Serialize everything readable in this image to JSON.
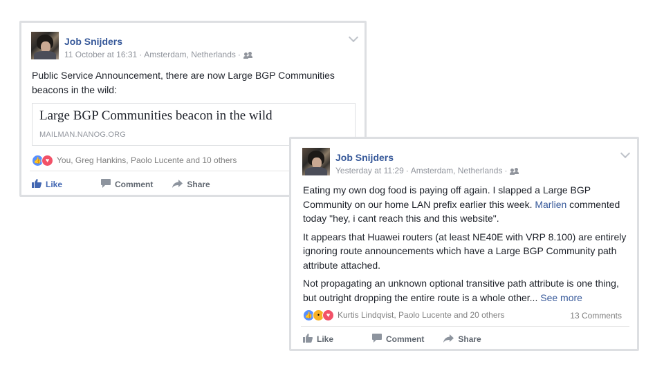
{
  "posts": [
    {
      "author": "Job Snijders",
      "time": "11 October at 16:31",
      "location": "Amsterdam, Netherlands",
      "body": "Public Service Announcement, there are now Large BGP Communities beacons in the wild:",
      "attachment": {
        "title": "Large BGP Communities beacon in the wild",
        "domain": "MAILMAN.NANOG.ORG"
      },
      "reactions_text": "You, Greg Hankins, Paolo Lucente and 10 others",
      "actions": {
        "like": "Like",
        "comment": "Comment",
        "share": "Share"
      }
    },
    {
      "author": "Job Snijders",
      "time": "Yesterday at 11:29",
      "location": "Amsterdam, Netherlands",
      "para1_before": "Eating my own dog food is paying off again. I slapped a Large BGP Community on our home LAN prefix earlier this week. ",
      "para1_link": "Marlien",
      "para1_after": " commented today \"hey, i cant reach this and this website\".",
      "para2": "It appears that Huawei routers (at least NE40E with VRP 8.100) are entirely ignoring route announcements which have a Large BGP Community path attribute attached.",
      "para3": "Not propagating an unknown optional transitive path attribute is one thing, but outright dropping the entire route is a whole other...",
      "see_more": "See more",
      "reactions_text": "Kurtis Lindqvist, Paolo Lucente and 20 others",
      "comments_count": "13 Comments",
      "actions": {
        "like": "Like",
        "comment": "Comment",
        "share": "Share"
      }
    }
  ],
  "colors": {
    "link": "#365899",
    "like_blue": "#4267b2",
    "love": "#f25268",
    "wow": "#f7b125"
  },
  "icons": {
    "friends": "friends-audience-icon",
    "menu": "chevron-down-icon"
  }
}
